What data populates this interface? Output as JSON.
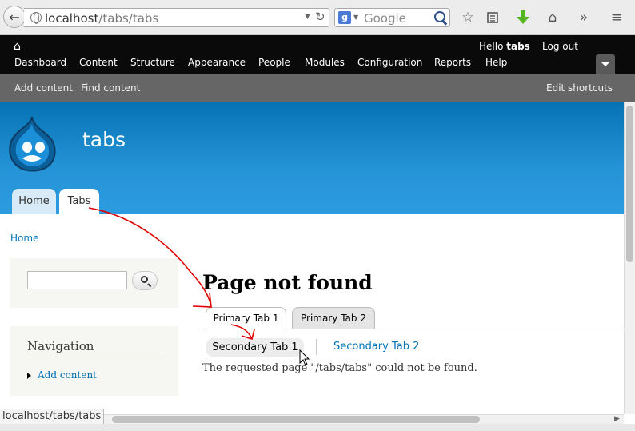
{
  "browser": {
    "url_host": "localhost",
    "url_path": "/tabs/tabs",
    "search_placeholder": "Google",
    "search_engine_letter": "g",
    "status_url": "localhost/tabs/tabs",
    "icons": [
      "back-icon",
      "globe-icon",
      "reload-icon",
      "search-icon",
      "bookmark-star-icon",
      "reading-list-icon",
      "download-icon",
      "home-icon",
      "overflow-icon",
      "hamburger-menu-icon"
    ]
  },
  "toolbar": {
    "greeting": "Hello",
    "username": "tabs",
    "logout": "Log out",
    "menu": [
      "Dashboard",
      "Content",
      "Structure",
      "Appearance",
      "People",
      "Modules",
      "Configuration",
      "Reports",
      "Help"
    ]
  },
  "shortcuts": {
    "items": [
      "Add content",
      "Find content"
    ],
    "edit": "Edit shortcuts"
  },
  "site": {
    "name": "tabs",
    "primary_tabs": [
      "Home",
      "Tabs"
    ],
    "header_color": "#1e8bcf"
  },
  "breadcrumb": "Home",
  "sidebar": {
    "search_value": "",
    "navigation_title": "Navigation",
    "navigation_links": [
      "Add content"
    ]
  },
  "main": {
    "title": "Page not found",
    "primary_tabs": [
      "Primary Tab 1",
      "Primary Tab 2"
    ],
    "secondary_tabs": [
      "Secondary Tab 1",
      "Secondary Tab 2"
    ],
    "message": "The requested page \"/tabs/tabs\" could not be found."
  },
  "colors": {
    "link": "#0071b3",
    "toolbar": "#0a0a0a",
    "shortcuts": "#666666",
    "annotation": "#e00000"
  }
}
